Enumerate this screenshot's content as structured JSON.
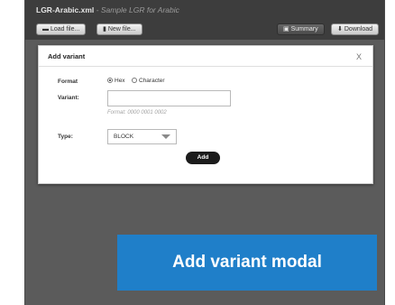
{
  "header": {
    "filename": "LGR-Arabic.xml",
    "separator": " - ",
    "subtitle": "Sample LGR for Arabic",
    "buttons": {
      "load": {
        "label": "Load file...",
        "icon": "folder-icon"
      },
      "new": {
        "label": "New file...",
        "icon": "document-icon"
      },
      "summary": {
        "label": "Summary",
        "icon": "summary-icon"
      },
      "download": {
        "label": "Download",
        "icon": "download-icon"
      }
    }
  },
  "modal": {
    "title": "Add variant",
    "close": "X",
    "format": {
      "label": "Format",
      "options": [
        {
          "label": "Hex",
          "selected": true
        },
        {
          "label": "Character",
          "selected": false
        }
      ]
    },
    "variant": {
      "label": "Variant:",
      "value": "",
      "placeholder": "",
      "hint": "Format: 0000 0001 0002"
    },
    "type": {
      "label": "Type:",
      "selected": "BLOCK"
    },
    "submit_label": "Add"
  },
  "caption": {
    "text": "Add variant modal",
    "color": "#1f7fc9"
  }
}
